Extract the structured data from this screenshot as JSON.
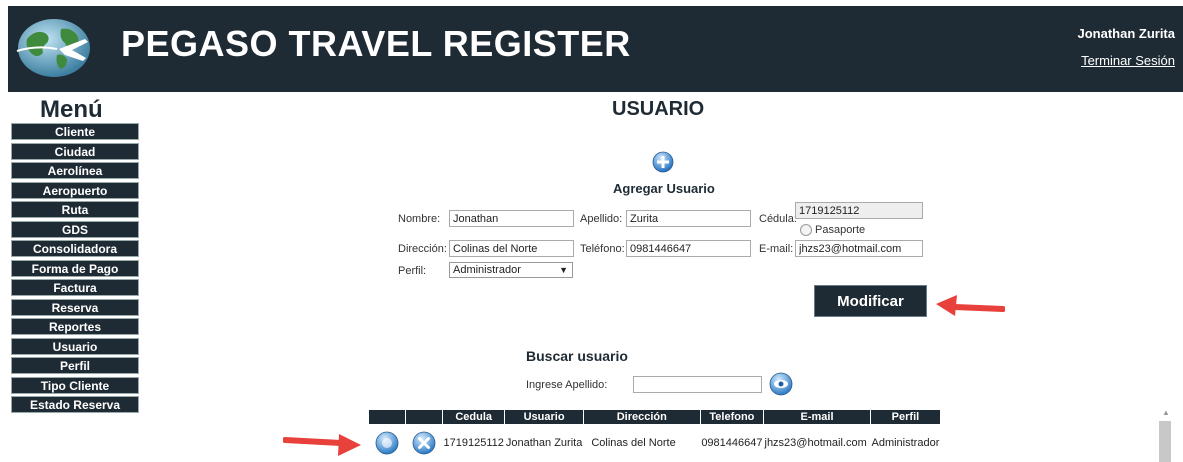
{
  "header": {
    "brand": "PEGASO TRAVEL REGISTER",
    "user_name": "Jonathan Zurita",
    "logout_label": "Terminar Sesión",
    "logo_icon": "globe-plane-icon"
  },
  "menu": {
    "title": "Menú",
    "items": [
      {
        "label": "Cliente"
      },
      {
        "label": "Ciudad"
      },
      {
        "label": "Aerolínea"
      },
      {
        "label": "Aeropuerto"
      },
      {
        "label": "Ruta"
      },
      {
        "label": "GDS"
      },
      {
        "label": "Consolidadora"
      },
      {
        "label": "Forma de Pago"
      },
      {
        "label": "Factura"
      },
      {
        "label": "Reserva"
      },
      {
        "label": "Reportes"
      },
      {
        "label": "Usuario"
      },
      {
        "label": "Perfil"
      },
      {
        "label": "Tipo Cliente"
      },
      {
        "label": "Estado Reserva"
      }
    ]
  },
  "page": {
    "title": "USUARIO",
    "add_label": "Agregar Usuario"
  },
  "form": {
    "nombre_label": "Nombre:",
    "nombre_value": "Jonathan",
    "apellido_label": "Apellido:",
    "apellido_value": "Zurita",
    "cedula_label": "Cédula:",
    "cedula_value": "1719125112",
    "pasaporte_label": "Pasaporte",
    "direccion_label": "Dirección:",
    "direccion_value": "Colinas del Norte",
    "telefono_label": "Teléfono:",
    "telefono_value": "0981446647",
    "email_label": "E-mail:",
    "email_value": "jhzs23@hotmail.com",
    "perfil_label": "Perfil:",
    "perfil_value": "Administrador",
    "modify_label": "Modificar"
  },
  "search": {
    "title": "Buscar usuario",
    "label": "Ingrese Apellido:",
    "value": ""
  },
  "table": {
    "headers": [
      "",
      "",
      "Cedula",
      "Usuario",
      "Dirección",
      "Telefono",
      "E-mail",
      "Perfil"
    ],
    "rows": [
      {
        "cedula": "1719125112",
        "usuario": "Jonathan Zurita",
        "direccion": "Colinas del Norte",
        "telefono": "0981446647",
        "email": "jhzs23@hotmail.com",
        "perfil": "Administrador"
      }
    ]
  },
  "colors": {
    "primary_dark": "#1f2b34",
    "annotation_red": "#e8403a"
  }
}
